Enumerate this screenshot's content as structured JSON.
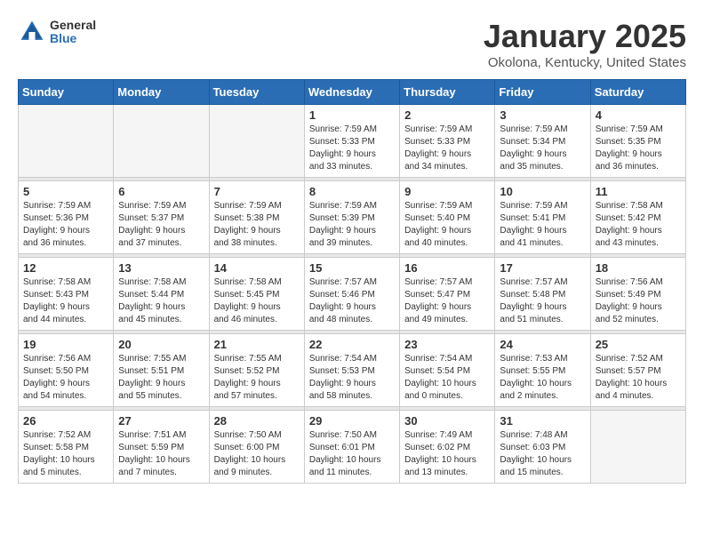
{
  "logo": {
    "general": "General",
    "blue": "Blue"
  },
  "title": "January 2025",
  "subtitle": "Okolona, Kentucky, United States",
  "headers": [
    "Sunday",
    "Monday",
    "Tuesday",
    "Wednesday",
    "Thursday",
    "Friday",
    "Saturday"
  ],
  "weeks": [
    {
      "days": [
        {
          "num": "",
          "info": ""
        },
        {
          "num": "",
          "info": ""
        },
        {
          "num": "",
          "info": ""
        },
        {
          "num": "1",
          "info": "Sunrise: 7:59 AM\nSunset: 5:33 PM\nDaylight: 9 hours\nand 33 minutes."
        },
        {
          "num": "2",
          "info": "Sunrise: 7:59 AM\nSunset: 5:33 PM\nDaylight: 9 hours\nand 34 minutes."
        },
        {
          "num": "3",
          "info": "Sunrise: 7:59 AM\nSunset: 5:34 PM\nDaylight: 9 hours\nand 35 minutes."
        },
        {
          "num": "4",
          "info": "Sunrise: 7:59 AM\nSunset: 5:35 PM\nDaylight: 9 hours\nand 36 minutes."
        }
      ]
    },
    {
      "days": [
        {
          "num": "5",
          "info": "Sunrise: 7:59 AM\nSunset: 5:36 PM\nDaylight: 9 hours\nand 36 minutes."
        },
        {
          "num": "6",
          "info": "Sunrise: 7:59 AM\nSunset: 5:37 PM\nDaylight: 9 hours\nand 37 minutes."
        },
        {
          "num": "7",
          "info": "Sunrise: 7:59 AM\nSunset: 5:38 PM\nDaylight: 9 hours\nand 38 minutes."
        },
        {
          "num": "8",
          "info": "Sunrise: 7:59 AM\nSunset: 5:39 PM\nDaylight: 9 hours\nand 39 minutes."
        },
        {
          "num": "9",
          "info": "Sunrise: 7:59 AM\nSunset: 5:40 PM\nDaylight: 9 hours\nand 40 minutes."
        },
        {
          "num": "10",
          "info": "Sunrise: 7:59 AM\nSunset: 5:41 PM\nDaylight: 9 hours\nand 41 minutes."
        },
        {
          "num": "11",
          "info": "Sunrise: 7:58 AM\nSunset: 5:42 PM\nDaylight: 9 hours\nand 43 minutes."
        }
      ]
    },
    {
      "days": [
        {
          "num": "12",
          "info": "Sunrise: 7:58 AM\nSunset: 5:43 PM\nDaylight: 9 hours\nand 44 minutes."
        },
        {
          "num": "13",
          "info": "Sunrise: 7:58 AM\nSunset: 5:44 PM\nDaylight: 9 hours\nand 45 minutes."
        },
        {
          "num": "14",
          "info": "Sunrise: 7:58 AM\nSunset: 5:45 PM\nDaylight: 9 hours\nand 46 minutes."
        },
        {
          "num": "15",
          "info": "Sunrise: 7:57 AM\nSunset: 5:46 PM\nDaylight: 9 hours\nand 48 minutes."
        },
        {
          "num": "16",
          "info": "Sunrise: 7:57 AM\nSunset: 5:47 PM\nDaylight: 9 hours\nand 49 minutes."
        },
        {
          "num": "17",
          "info": "Sunrise: 7:57 AM\nSunset: 5:48 PM\nDaylight: 9 hours\nand 51 minutes."
        },
        {
          "num": "18",
          "info": "Sunrise: 7:56 AM\nSunset: 5:49 PM\nDaylight: 9 hours\nand 52 minutes."
        }
      ]
    },
    {
      "days": [
        {
          "num": "19",
          "info": "Sunrise: 7:56 AM\nSunset: 5:50 PM\nDaylight: 9 hours\nand 54 minutes."
        },
        {
          "num": "20",
          "info": "Sunrise: 7:55 AM\nSunset: 5:51 PM\nDaylight: 9 hours\nand 55 minutes."
        },
        {
          "num": "21",
          "info": "Sunrise: 7:55 AM\nSunset: 5:52 PM\nDaylight: 9 hours\nand 57 minutes."
        },
        {
          "num": "22",
          "info": "Sunrise: 7:54 AM\nSunset: 5:53 PM\nDaylight: 9 hours\nand 58 minutes."
        },
        {
          "num": "23",
          "info": "Sunrise: 7:54 AM\nSunset: 5:54 PM\nDaylight: 10 hours\nand 0 minutes."
        },
        {
          "num": "24",
          "info": "Sunrise: 7:53 AM\nSunset: 5:55 PM\nDaylight: 10 hours\nand 2 minutes."
        },
        {
          "num": "25",
          "info": "Sunrise: 7:52 AM\nSunset: 5:57 PM\nDaylight: 10 hours\nand 4 minutes."
        }
      ]
    },
    {
      "days": [
        {
          "num": "26",
          "info": "Sunrise: 7:52 AM\nSunset: 5:58 PM\nDaylight: 10 hours\nand 5 minutes."
        },
        {
          "num": "27",
          "info": "Sunrise: 7:51 AM\nSunset: 5:59 PM\nDaylight: 10 hours\nand 7 minutes."
        },
        {
          "num": "28",
          "info": "Sunrise: 7:50 AM\nSunset: 6:00 PM\nDaylight: 10 hours\nand 9 minutes."
        },
        {
          "num": "29",
          "info": "Sunrise: 7:50 AM\nSunset: 6:01 PM\nDaylight: 10 hours\nand 11 minutes."
        },
        {
          "num": "30",
          "info": "Sunrise: 7:49 AM\nSunset: 6:02 PM\nDaylight: 10 hours\nand 13 minutes."
        },
        {
          "num": "31",
          "info": "Sunrise: 7:48 AM\nSunset: 6:03 PM\nDaylight: 10 hours\nand 15 minutes."
        },
        {
          "num": "",
          "info": ""
        }
      ]
    }
  ]
}
